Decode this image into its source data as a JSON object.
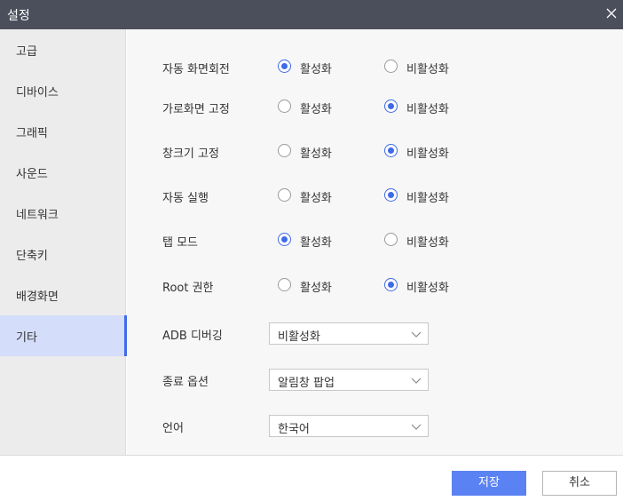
{
  "window": {
    "title": "설정"
  },
  "sidebar": {
    "items": [
      {
        "label": "고급"
      },
      {
        "label": "디바이스"
      },
      {
        "label": "그래픽"
      },
      {
        "label": "사운드"
      },
      {
        "label": "네트워크"
      },
      {
        "label": "단축키"
      },
      {
        "label": "배경화면"
      },
      {
        "label": "기타",
        "active": true
      }
    ]
  },
  "settings": {
    "toggles": [
      {
        "label": "자동 화면회전",
        "on_label": "활성화",
        "off_label": "비활성화",
        "selected": "on"
      },
      {
        "label": "가로화면 고정",
        "on_label": "활성화",
        "off_label": "비활성화",
        "selected": "off"
      },
      {
        "label": "창크기 고정",
        "on_label": "활성화",
        "off_label": "비활성화",
        "selected": "off"
      },
      {
        "label": "자동 실행",
        "on_label": "활성화",
        "off_label": "비활성화",
        "selected": "off"
      },
      {
        "label": "탭 모드",
        "on_label": "활성화",
        "off_label": "비활성화",
        "selected": "on"
      },
      {
        "label": "Root 권한",
        "on_label": "활성화",
        "off_label": "비활성화",
        "selected": "off"
      }
    ],
    "selects": [
      {
        "label": "ADB 디버깅",
        "value": "비활성화"
      },
      {
        "label": "종료 옵션",
        "value": "알림창 팝업"
      },
      {
        "label": "언어",
        "value": "한국어"
      }
    ]
  },
  "footer": {
    "save_label": "저장",
    "cancel_label": "취소"
  },
  "colors": {
    "titlebar": "#4b4f5c",
    "accent": "#3f6ae8",
    "primary_button": "#5b82f2",
    "sidebar_active": "#d4ddf9"
  },
  "icons": {
    "close": "close-icon",
    "dropdown": "chevron-down-icon"
  }
}
